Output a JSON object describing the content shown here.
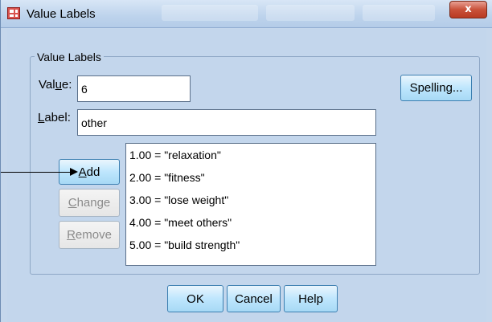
{
  "window": {
    "title": "Value Labels",
    "close_label": "x"
  },
  "group": {
    "legend": "Value Labels"
  },
  "value_field": {
    "label_pre": "Val",
    "label_mnemonic": "u",
    "label_post": "e:",
    "value": "6"
  },
  "label_field": {
    "label_mnemonic": "L",
    "label_post": "abel:",
    "value": "other"
  },
  "buttons": {
    "spelling": "Spelling...",
    "add_mnemonic": "A",
    "add_rest": "dd",
    "change_mnemonic": "C",
    "change_rest": "hange",
    "remove_mnemonic": "R",
    "remove_rest": "emove",
    "ok": "OK",
    "cancel": "Cancel",
    "help": "Help"
  },
  "value_list": [
    "1.00 = \"relaxation\"",
    "2.00 = \"fitness\"",
    "3.00 = \"lose weight\"",
    "4.00 = \"meet others\"",
    "5.00 = \"build strength\""
  ],
  "colors": {
    "dialog_bg": "#c3d6ec",
    "button_active": "#bee6fd",
    "close_button": "#c9513a"
  }
}
